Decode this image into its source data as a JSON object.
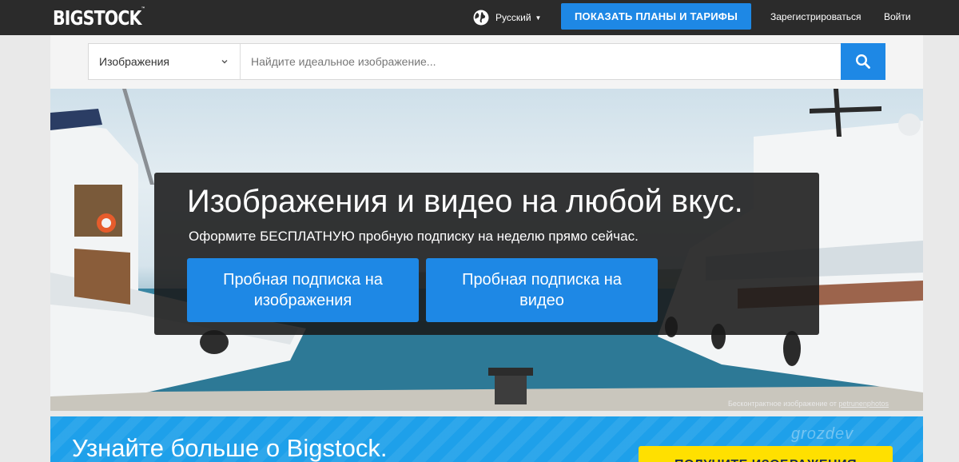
{
  "header": {
    "logo": "BIGSTOCK",
    "logo_tm": "™",
    "language": "Русский",
    "plans_button": "ПОКАЗАТЬ ПЛАНЫ И ТАРИФЫ",
    "register_link": "Зарегистрироваться",
    "login_link": "Войти"
  },
  "search": {
    "type_selected": "Изображения",
    "placeholder": "Найдите идеальное изображение..."
  },
  "hero": {
    "title": "Изображения и видео на любой вкус.",
    "subtitle": "Оформите БЕСПЛАТНУЮ пробную подписку на неделю прямо сейчас.",
    "cta_images_line1": "Пробная подписка на",
    "cta_images_line2": "изображения",
    "cta_video_line1": "Пробная подписка на",
    "cta_video_line2": "видео",
    "credit_text": "Бесконтрактное изображение от",
    "credit_author": "petrunenphotos"
  },
  "promo": {
    "title": "Узнайте больше о Bigstock.",
    "button": "ПОЛУЧИТЕ ИЗОБРАЖЕНИЯ",
    "watermark": "grozdev"
  },
  "colors": {
    "topbar": "#2b2b2b",
    "accent_blue": "#1e88e5",
    "promo_blue": "#1ea0ea",
    "promo_button_yellow": "#ffe000"
  },
  "icons": {
    "language": "globe-icon",
    "language_caret": "caret-down-icon",
    "search_type": "chevron-down-icon",
    "search_button": "search-icon"
  }
}
